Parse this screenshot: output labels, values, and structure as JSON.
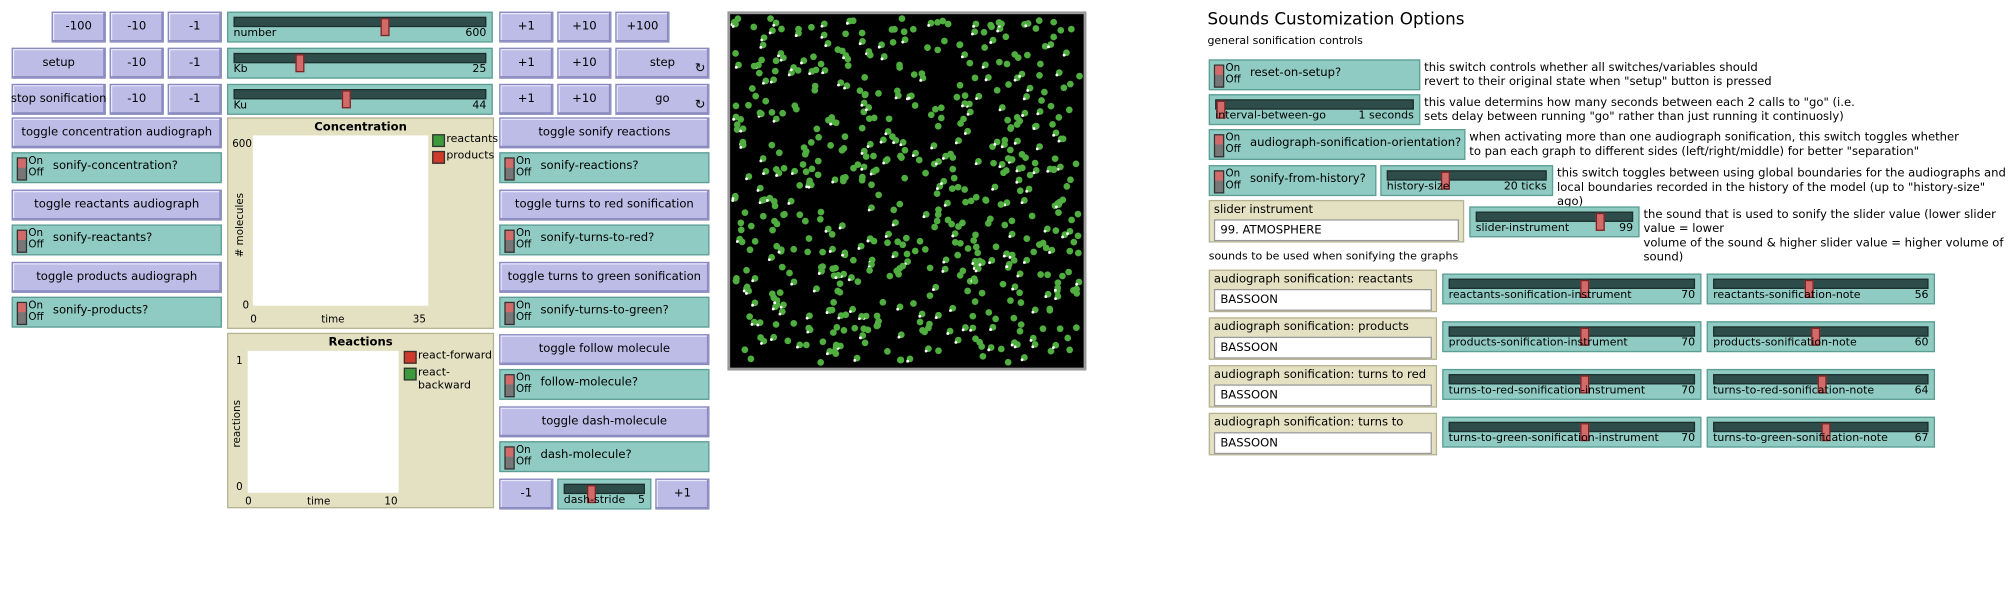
{
  "buttons": {
    "m100": "-100",
    "m10": "-10",
    "m1": "-1",
    "p1": "+1",
    "p10": "+10",
    "p100": "+100",
    "setup": "setup",
    "stop_sonification": "stop sonification",
    "step": "step",
    "go": "go",
    "toggle_concentration": "toggle concentration audiograph",
    "toggle_reactants": "toggle reactants audiograph",
    "toggle_products": "toggle products audiograph",
    "toggle_sonify_reactions": "toggle sonify reactions",
    "toggle_turns_red": "toggle turns to red sonification",
    "toggle_turns_green": "toggle turns to green sonification",
    "toggle_follow": "toggle follow molecule",
    "toggle_dash": "toggle dash-molecule",
    "forever_icon": "↻"
  },
  "sliders": {
    "number": {
      "label": "number",
      "value": "600",
      "level": 0.6
    },
    "kb": {
      "label": "Kb",
      "value": "25",
      "level": 0.25
    },
    "ku": {
      "label": "Ku",
      "value": "44",
      "level": 0.44
    },
    "dash_stride": {
      "label": "dash-stride",
      "value": "5",
      "level": 0.3
    },
    "interval": {
      "label": "interval-between-go",
      "value": "1 seconds",
      "level": 0.0
    },
    "history_size": {
      "label": "history-size",
      "value": "20 ticks",
      "level": 0.35
    },
    "slider_instrument": {
      "label": "slider-instrument",
      "value": "99",
      "level": 0.8
    },
    "reactants_instr": {
      "label": "reactants-sonification-instrument",
      "value": "70",
      "level": 0.55
    },
    "reactants_note": {
      "label": "reactants-sonification-note",
      "value": "56",
      "level": 0.44
    },
    "products_instr": {
      "label": "products-sonification-instrument",
      "value": "70",
      "level": 0.55
    },
    "products_note": {
      "label": "products-sonification-note",
      "value": "60",
      "level": 0.47
    },
    "red_instr": {
      "label": "turns-to-red-sonification-instrument",
      "value": "70",
      "level": 0.55
    },
    "red_note": {
      "label": "turns-to-red-sonification-note",
      "value": "64",
      "level": 0.5
    },
    "green_instr": {
      "label": "turns-to-green-sonification-instrument",
      "value": "70",
      "level": 0.55
    },
    "green_note": {
      "label": "turns-to-green-sonification-note",
      "value": "67",
      "level": 0.52
    }
  },
  "switch_text": {
    "on": "On",
    "off": "Off"
  },
  "switches": {
    "sonify_concentration": "sonify-concentration?",
    "sonify_reactants": "sonify-reactants?",
    "sonify_products": "sonify-products?",
    "sonify_reactions": "sonify-reactions?",
    "sonify_red": "sonify-turns-to-red?",
    "sonify_green": "sonify-turns-to-green?",
    "follow_molecule": "follow-molecule?",
    "dash_molecule": "dash-molecule?",
    "reset_on_setup": "reset-on-setup?",
    "orientation": "audiograph-sonification-orientation?",
    "from_history": "sonify-from-history?"
  },
  "plots": {
    "concentration": {
      "title": "Concentration",
      "ylabel": "# molecules",
      "xlabel": "time",
      "ymax": "600",
      "ymin": "0",
      "xmin": "0",
      "xmax": "35",
      "legend": [
        {
          "name": "reactants",
          "color": "#3c9a3c"
        },
        {
          "name": "products",
          "color": "#d03a2a"
        }
      ]
    },
    "reactions": {
      "title": "Reactions",
      "ylabel": "reactions",
      "xlabel": "time",
      "ymax": "1",
      "ymin": "0",
      "xmin": "0",
      "xmax": "10",
      "legend": [
        {
          "name": "react-forward",
          "color": "#d03a2a"
        },
        {
          "name": "react-backward",
          "color": "#3c9a3c"
        }
      ]
    }
  },
  "options": {
    "title": "Sounds Customization Options",
    "subtitle": "general sonification controls",
    "graphs_heading": "sounds to be used when sonifying the graphs",
    "note_reset_1": "this switch controls whether all switches/variables should",
    "note_reset_2": "revert to their original state when \"setup\" button is pressed",
    "note_interval_1": "this value determins how many seconds between each 2 calls to \"go\" (i.e.",
    "note_interval_2": "sets delay between running \"go\" rather than just running it continuosly)",
    "note_orient_1": "when activating more than one audiograph sonification, this switch toggles whether",
    "note_orient_2": "to pan each graph to different sides (left/right/middle) for better \"separation\"",
    "note_history_1": "this switch toggles between using global boundaries for the audiographs and",
    "note_history_2": "local boundaries recorded in the history of the model (up to \"history-size\" ago)",
    "note_slider_1": "the sound that is used to sonify the slider value (lower slider value = lower",
    "note_slider_2": "volume of the sound & higher slider value = higher volume of sound)"
  },
  "choosers": {
    "slider_instrument": {
      "label": "slider instrument",
      "value": "99. ATMOSPHERE"
    },
    "reactants": {
      "label": "audiograph sonification: reactants",
      "value": "BASSOON"
    },
    "products": {
      "label": "audiograph sonification: products",
      "value": "BASSOON"
    },
    "red": {
      "label": "audiograph sonification: turns to red",
      "value": "BASSOON"
    },
    "green": {
      "label": "audiograph sonification: turns to green",
      "value": "BASSOON"
    }
  },
  "colors": {
    "molecule": "#4fae3f",
    "molecule_dot": "#ffffff",
    "view_bg": "#000000"
  }
}
